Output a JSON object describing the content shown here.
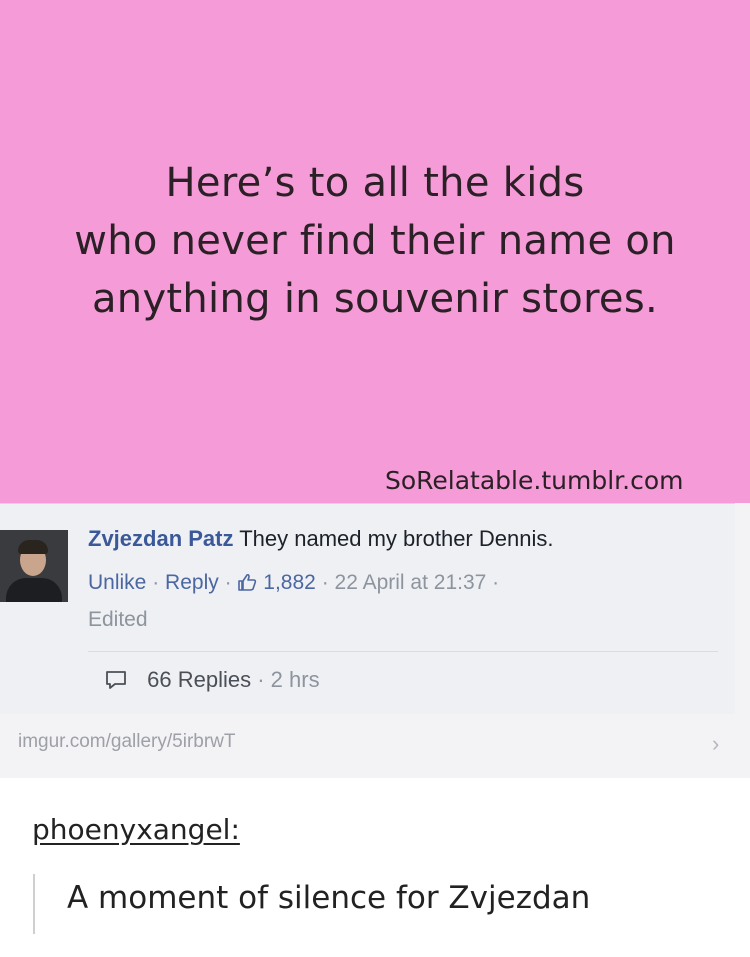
{
  "quote": {
    "lines": [
      "Here’s to all the kids",
      "who never find their name on",
      "anything in souvenir stores."
    ],
    "watermark": "SoRelatable.tumblr.com"
  },
  "comment": {
    "author": "Zvjezdan Patz",
    "text": "They named my brother Dennis.",
    "actions": {
      "unlike": "Unlike",
      "reply": "Reply",
      "likes": "1,882",
      "date": "22 April at 21:37",
      "edited": "Edited",
      "separator": "·"
    },
    "replies": {
      "count_label": "66 Replies",
      "time": "2 hrs"
    },
    "source_url": "imgur.com/gallery/5irbrwT",
    "chevron": "›"
  },
  "reblog": {
    "username": "phoenyxangel:",
    "text": "A moment of silence for Zvjezdan"
  },
  "colors": {
    "pink_background": "#f59cd8",
    "facebook_blue": "#3b5998",
    "meta_grey": "#8d949e"
  },
  "icons": {
    "like": "thumbs-up-icon",
    "reply": "speech-bubble-icon",
    "forward": "chevron-right-icon"
  }
}
